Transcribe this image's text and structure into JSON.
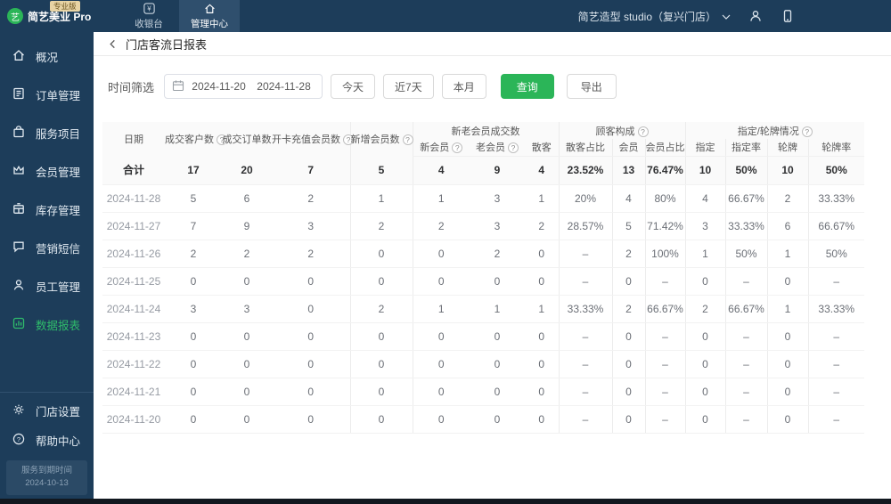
{
  "brand": {
    "name": "简艺美业 Pro",
    "badge": "专业版",
    "logo_glyph": "艺"
  },
  "topnav": {
    "tabs": [
      {
        "label": "收银台"
      },
      {
        "label": "管理中心"
      }
    ],
    "store": "简艺造型 studio（复兴门店）"
  },
  "sidebar": {
    "items": [
      {
        "label": "概况"
      },
      {
        "label": "订单管理"
      },
      {
        "label": "服务项目"
      },
      {
        "label": "会员管理"
      },
      {
        "label": "库存管理"
      },
      {
        "label": "营销短信"
      },
      {
        "label": "员工管理"
      },
      {
        "label": "数据报表"
      }
    ],
    "footer": [
      {
        "label": "门店设置"
      },
      {
        "label": "帮助中心"
      }
    ],
    "expiry": {
      "label": "服务到期时间",
      "date": "2024-10-13"
    }
  },
  "page": {
    "title": "门店客流日报表"
  },
  "filters": {
    "label": "时间筛选",
    "date_start": "2024-11-20",
    "date_end": "2024-11-28",
    "quick": [
      "今天",
      "近7天",
      "本月"
    ],
    "query": "查询",
    "export": "导出"
  },
  "table": {
    "head": {
      "date": "日期",
      "simple": [
        {
          "label": "成交客户数",
          "help": true
        },
        {
          "label": "成交订单数",
          "help": false
        },
        {
          "label": "开卡充值会员数",
          "help": true
        },
        {
          "label": "新增会员数",
          "help": true
        }
      ],
      "groups": [
        {
          "label": "新老会员成交数",
          "help": false,
          "cols": [
            {
              "label": "新会员",
              "help": true
            },
            {
              "label": "老会员",
              "help": true
            },
            {
              "label": "散客",
              "help": false
            }
          ]
        },
        {
          "label": "顾客构成",
          "help": true,
          "cols": [
            {
              "label": "散客占比",
              "help": false
            },
            {
              "label": "会员",
              "help": false
            },
            {
              "label": "会员占比",
              "help": false
            }
          ]
        },
        {
          "label": "指定/轮牌情况",
          "help": true,
          "cols": [
            {
              "label": "指定",
              "help": false
            },
            {
              "label": "指定率",
              "help": false
            },
            {
              "label": "轮牌",
              "help": false
            },
            {
              "label": "轮牌率",
              "help": false
            }
          ]
        }
      ]
    },
    "total_label": "合计",
    "total_row": [
      "17",
      "20",
      "7",
      "5",
      "4",
      "9",
      "4",
      "23.52%",
      "13",
      "76.47%",
      "10",
      "50%",
      "10",
      "50%"
    ],
    "rows": [
      {
        "date": "2024-11-28",
        "values": [
          "5",
          "6",
          "2",
          "1",
          "1",
          "3",
          "1",
          "20%",
          "4",
          "80%",
          "4",
          "66.67%",
          "2",
          "33.33%"
        ]
      },
      {
        "date": "2024-11-27",
        "values": [
          "7",
          "9",
          "3",
          "2",
          "2",
          "3",
          "2",
          "28.57%",
          "5",
          "71.42%",
          "3",
          "33.33%",
          "6",
          "66.67%"
        ]
      },
      {
        "date": "2024-11-26",
        "values": [
          "2",
          "2",
          "2",
          "0",
          "0",
          "2",
          "0",
          "–",
          "2",
          "100%",
          "1",
          "50%",
          "1",
          "50%"
        ]
      },
      {
        "date": "2024-11-25",
        "values": [
          "0",
          "0",
          "0",
          "0",
          "0",
          "0",
          "0",
          "–",
          "0",
          "–",
          "0",
          "–",
          "0",
          "–"
        ]
      },
      {
        "date": "2024-11-24",
        "values": [
          "3",
          "3",
          "0",
          "2",
          "1",
          "1",
          "1",
          "33.33%",
          "2",
          "66.67%",
          "2",
          "66.67%",
          "1",
          "33.33%"
        ]
      },
      {
        "date": "2024-11-23",
        "values": [
          "0",
          "0",
          "0",
          "0",
          "0",
          "0",
          "0",
          "–",
          "0",
          "–",
          "0",
          "–",
          "0",
          "–"
        ]
      },
      {
        "date": "2024-11-22",
        "values": [
          "0",
          "0",
          "0",
          "0",
          "0",
          "0",
          "0",
          "–",
          "0",
          "–",
          "0",
          "–",
          "0",
          "–"
        ]
      },
      {
        "date": "2024-11-21",
        "values": [
          "0",
          "0",
          "0",
          "0",
          "0",
          "0",
          "0",
          "–",
          "0",
          "–",
          "0",
          "–",
          "0",
          "–"
        ]
      },
      {
        "date": "2024-11-20",
        "values": [
          "0",
          "0",
          "0",
          "0",
          "0",
          "0",
          "0",
          "–",
          "0",
          "–",
          "0",
          "–",
          "0",
          "–"
        ]
      }
    ]
  },
  "colors": {
    "accent_green": "#2bb558",
    "navy": "#1d3d5a"
  }
}
